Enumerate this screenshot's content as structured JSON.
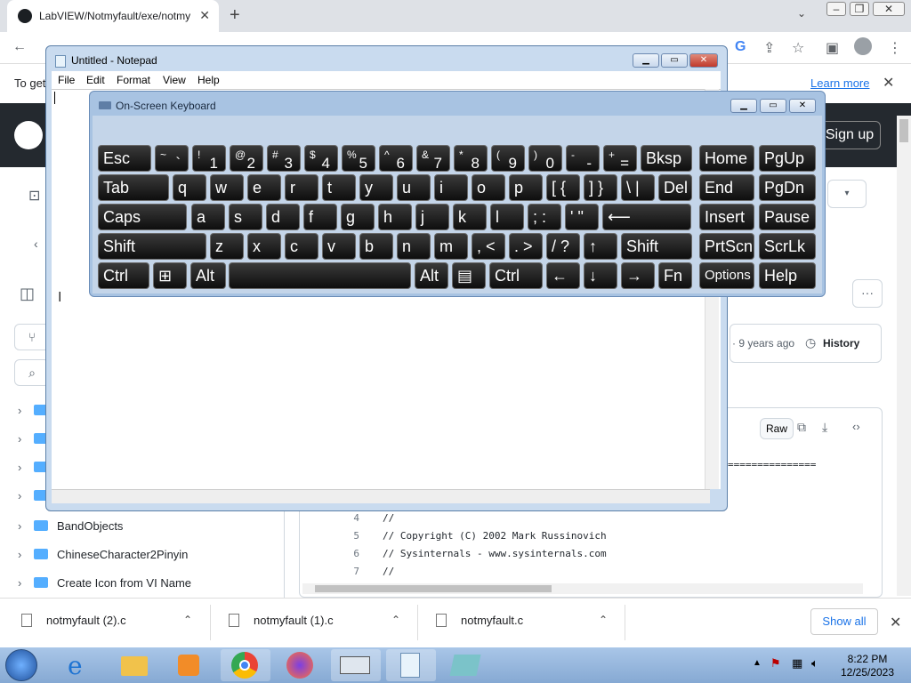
{
  "browser": {
    "tab_title": "LabVIEW/Notmyfault/exe/notmy",
    "infobar_text": "To get",
    "infobar_link": "Learn more"
  },
  "github": {
    "sign_up": "Sign up",
    "history_time": "· 9 years ago",
    "history_label": "History",
    "raw_label": "Raw",
    "tree": [
      {
        "label": "BandObjects"
      },
      {
        "label": "ChineseCharacter2Pinyin"
      },
      {
        "label": "Create Icon from VI Name"
      }
    ],
    "code_rest": "===============",
    "code": [
      {
        "n": "4",
        "text": "//"
      },
      {
        "n": "5",
        "text": "// Copyright (C) 2002 Mark Russinovich"
      },
      {
        "n": "6",
        "text": "// Sysinternals - www.sysinternals.com"
      },
      {
        "n": "7",
        "text": "//"
      }
    ]
  },
  "downloads": {
    "items": [
      {
        "name": "notmyfault (2).c"
      },
      {
        "name": "notmyfault (1).c"
      },
      {
        "name": "notmyfault.c"
      }
    ],
    "show_all": "Show all"
  },
  "notepad": {
    "title": "Untitled - Notepad",
    "menu": [
      "File",
      "Edit",
      "Format",
      "View",
      "Help"
    ]
  },
  "osk": {
    "title": "On-Screen Keyboard",
    "row1": [
      {
        "main": "Esc"
      },
      {
        "sup": "~",
        "low": "`"
      },
      {
        "sup": "!",
        "low": "1"
      },
      {
        "sup": "@",
        "low": "2"
      },
      {
        "sup": "#",
        "low": "3"
      },
      {
        "sup": "$",
        "low": "4"
      },
      {
        "sup": "%",
        "low": "5"
      },
      {
        "sup": "^",
        "low": "6"
      },
      {
        "sup": "&",
        "low": "7"
      },
      {
        "sup": "*",
        "low": "8"
      },
      {
        "sup": "(",
        "low": "9"
      },
      {
        "sup": ")",
        "low": "0"
      },
      {
        "sup": "-",
        "low": "-"
      },
      {
        "sup": "+",
        "low": "="
      },
      {
        "main": "Bksp"
      },
      {
        "main": "Home"
      },
      {
        "main": "PgUp"
      }
    ],
    "row2": [
      "Tab",
      "q",
      "w",
      "e",
      "r",
      "t",
      "y",
      "u",
      "i",
      "o",
      "p",
      "[ {",
      "] }",
      "\\ |",
      "Del",
      "End",
      "PgDn"
    ],
    "row3": [
      "Caps",
      "a",
      "s",
      "d",
      "f",
      "g",
      "h",
      "j",
      "k",
      "l",
      "; :",
      "' \"",
      "⟵",
      "Insert",
      "Pause"
    ],
    "row4": [
      "Shift",
      "z",
      "x",
      "c",
      "v",
      "b",
      "n",
      "m",
      ", <",
      ". >",
      "/ ?",
      "↑",
      "Shift",
      "PrtScn",
      "ScrLk"
    ],
    "row5": [
      "Ctrl",
      "⊞",
      "Alt",
      "",
      "Alt",
      "▤",
      "Ctrl",
      "←",
      "↓",
      "→",
      "Fn",
      "Options",
      "Help"
    ]
  },
  "taskbar": {
    "time": "8:22 PM",
    "date": "12/25/2023"
  }
}
